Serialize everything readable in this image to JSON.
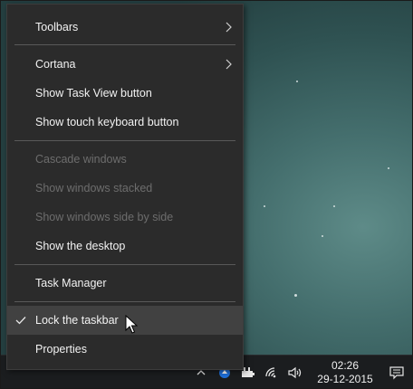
{
  "menu": {
    "items": [
      {
        "label": "Toolbars",
        "submenu": true,
        "enabled": true
      },
      {
        "label": "Cortana",
        "submenu": true,
        "enabled": true
      },
      {
        "label": "Show Task View button",
        "enabled": true
      },
      {
        "label": "Show touch keyboard button",
        "enabled": true
      },
      {
        "label": "Cascade windows",
        "enabled": false
      },
      {
        "label": "Show windows stacked",
        "enabled": false
      },
      {
        "label": "Show windows side by side",
        "enabled": false
      },
      {
        "label": "Show the desktop",
        "enabled": true
      },
      {
        "label": "Task Manager",
        "enabled": true
      },
      {
        "label": "Lock the taskbar",
        "enabled": true,
        "checked": true,
        "hovered": true
      },
      {
        "label": "Properties",
        "enabled": true
      }
    ]
  },
  "taskbar": {
    "clock": {
      "time": "02:26",
      "date": "29-12-2015"
    },
    "tray_icons": [
      "chevron-up-icon",
      "app-tray-icon",
      "power-plug-icon",
      "wifi-icon",
      "volume-icon"
    ],
    "notification_icon": "action-center-icon"
  },
  "colors": {
    "menu_bg": "#2b2b2b",
    "menu_hover": "#414141",
    "text": "#f2f2f2",
    "disabled_text": "#6d6d6d",
    "taskbar_bg": "#1b1d1f"
  }
}
